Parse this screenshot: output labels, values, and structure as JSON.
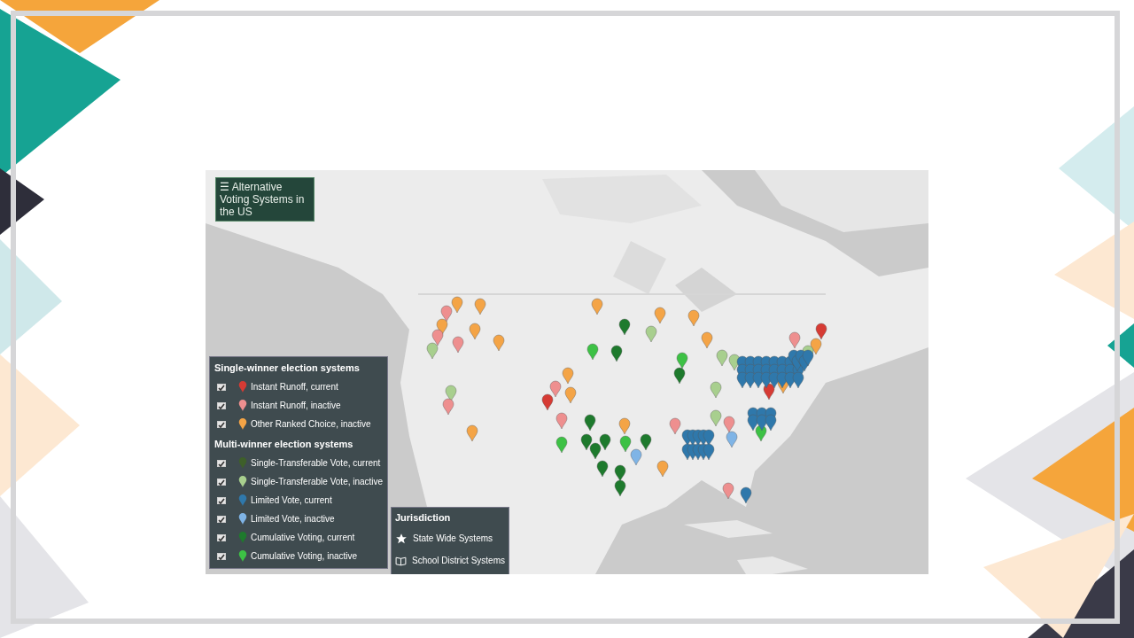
{
  "map_title": {
    "icon": "☰",
    "text": "Alternative Voting Systems in the US"
  },
  "legend": {
    "groups": [
      {
        "heading": "Single-winner election systems",
        "items": [
          {
            "label": "Instant Runoff, current",
            "color": "#d63b34",
            "checked": true
          },
          {
            "label": "Instant Runoff, inactive",
            "color": "#ee8f8f",
            "checked": true
          },
          {
            "label": "Other Ranked Choice, inactive",
            "color": "#f4a446",
            "checked": true
          }
        ]
      },
      {
        "heading": "Multi-winner election systems",
        "items": [
          {
            "label": "Single-Transferable Vote, current",
            "color": "#3e5f2a",
            "checked": true
          },
          {
            "label": "Single-Transferable Vote, inactive",
            "color": "#a8cf8e",
            "checked": true
          },
          {
            "label": "Limited Vote, current",
            "color": "#2f78ab",
            "checked": true
          },
          {
            "label": "Limited Vote, inactive",
            "color": "#7fb4e6",
            "checked": true
          },
          {
            "label": "Cumulative Voting, current",
            "color": "#1e7a2d",
            "checked": true
          },
          {
            "label": "Cumulative Voting, inactive",
            "color": "#3dc145",
            "checked": true
          }
        ]
      }
    ]
  },
  "jurisdiction": {
    "heading": "Jurisdiction",
    "items": [
      {
        "kind": "star",
        "label": "State Wide Systems"
      },
      {
        "kind": "school",
        "label": "School District Systems"
      }
    ]
  }
}
